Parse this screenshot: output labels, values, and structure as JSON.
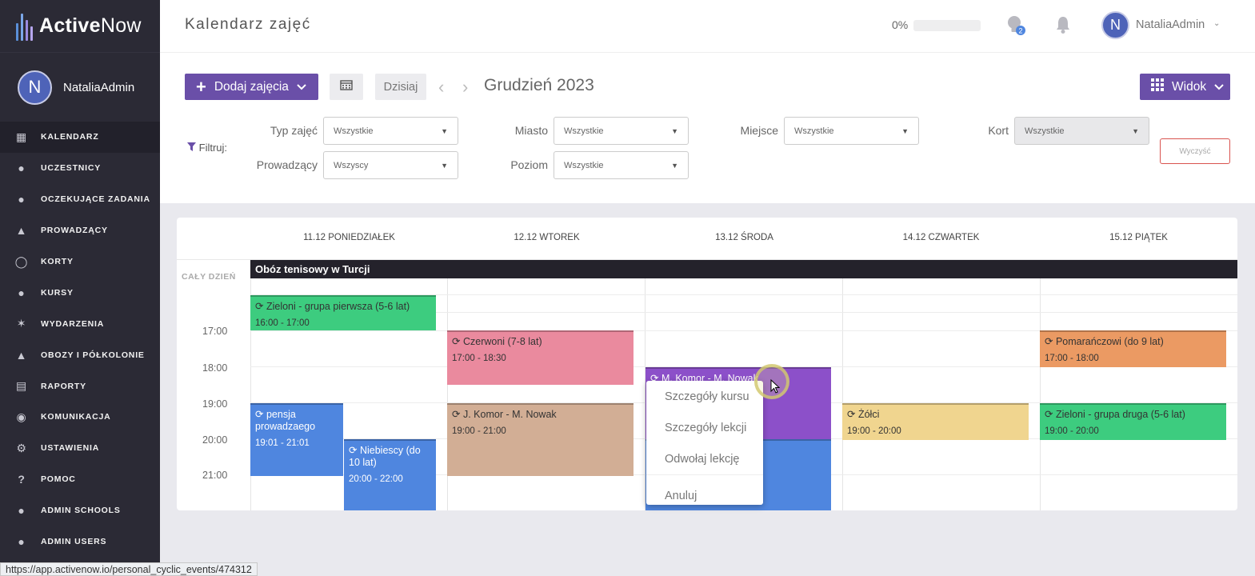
{
  "brand": {
    "name_bold": "Active",
    "name_rest": "Now"
  },
  "sidebar": {
    "user": {
      "initial": "N",
      "name": "NataliaAdmin"
    },
    "items": [
      {
        "label": "KALENDARZ",
        "icon": "calendar-icon",
        "active": true
      },
      {
        "label": "UCZESTNICY",
        "icon": "user-icon"
      },
      {
        "label": "OCZEKUJĄCE ZADANIA",
        "icon": "user-plus-icon"
      },
      {
        "label": "PROWADZĄCY",
        "icon": "graduation-cap-icon"
      },
      {
        "label": "KORTY",
        "icon": "tennis-racket-icon"
      },
      {
        "label": "KURSY",
        "icon": "users-icon"
      },
      {
        "label": "WYDARZENIA",
        "icon": "party-icon"
      },
      {
        "label": "OBOZY I PÓŁKOLONIE",
        "icon": "tent-icon"
      },
      {
        "label": "RAPORTY",
        "icon": "chart-icon"
      },
      {
        "label": "KOMUNIKACJA",
        "icon": "chat-icon"
      },
      {
        "label": "USTAWIENIA",
        "icon": "gear-icon"
      },
      {
        "label": "POMOC",
        "icon": "help-icon"
      },
      {
        "label": "ADMIN SCHOOLS",
        "icon": "user-icon"
      },
      {
        "label": "ADMIN USERS",
        "icon": "user-icon"
      }
    ]
  },
  "header": {
    "title": "Kalendarz zajęć",
    "progress_label": "0%",
    "progress_value": 0,
    "notifications_badge": "2",
    "user": {
      "initial": "N",
      "name": "NataliaAdmin"
    }
  },
  "toolbar": {
    "add_label": "Dodaj zajęcia",
    "today_label": "Dzisiaj",
    "month_label": "Grudzień 2023",
    "view_label": "Widok"
  },
  "filters": {
    "title": "Filtruj:",
    "type": {
      "label": "Typ zajęć",
      "value": "Wszystkie"
    },
    "city": {
      "label": "Miasto",
      "value": "Wszystkie"
    },
    "place": {
      "label": "Miejsce",
      "value": "Wszystkie"
    },
    "court": {
      "label": "Kort",
      "value": "Wszystkie"
    },
    "instructor": {
      "label": "Prowadzący",
      "value": "Wszyscy"
    },
    "level": {
      "label": "Poziom",
      "value": "Wszystkie"
    },
    "clear_label": "Wyczyść"
  },
  "calendar": {
    "days": [
      "11.12 PONIEDZIAŁEK",
      "12.12 WTOREK",
      "13.12 ŚRODA",
      "14.12 CZWARTEK",
      "15.12 PIĄTEK"
    ],
    "allday_label": "CAŁY DZIEŃ",
    "allday_event": "Obóz tenisowy w Turcji",
    "times": [
      "17:00",
      "18:00",
      "19:00",
      "20:00",
      "21:00"
    ],
    "events": [
      {
        "title": "Zieloni - grupa pierwsza (5-6 lat)",
        "time": "16:00 - 17:00",
        "color": "#3dcc7f"
      },
      {
        "title": "Czerwoni (7-8 lat)",
        "time": "17:00 - 18:30",
        "color": "#ea8a9e"
      },
      {
        "title": "Pomarańczowi (do 9 lat)",
        "time": "17:00 - 18:00",
        "color": "#eb9a63"
      },
      {
        "title": "M. Komor - M. Nowak",
        "time": "",
        "color": "#8c50c9"
      },
      {
        "title": "pensja prowadzaego",
        "time": "19:01 - 21:01",
        "color": "#4f86df"
      },
      {
        "title": "Niebiescy (do 10 lat)",
        "time": "20:00 - 22:00",
        "color": "#4f86df"
      },
      {
        "title": "J. Komor - M. Nowak",
        "time": "19:00 - 21:00",
        "color": "#d2ae95"
      },
      {
        "title": "Żółci",
        "time": "19:00 - 20:00",
        "color": "#f0d58f"
      },
      {
        "title": "Zieloni - grupa druga (5-6 lat)",
        "time": "19:00 - 20:00",
        "color": "#3dcc7f"
      },
      {
        "title": "",
        "time": "",
        "color": "#4f86df"
      }
    ]
  },
  "context_menu": {
    "items": [
      "Szczegóły kursu",
      "Szczegóły lekcji",
      "Odwołaj lekcję",
      "Anuluj"
    ]
  },
  "statusbar": {
    "url": "https://app.activenow.io/personal_cyclic_events/474312"
  }
}
